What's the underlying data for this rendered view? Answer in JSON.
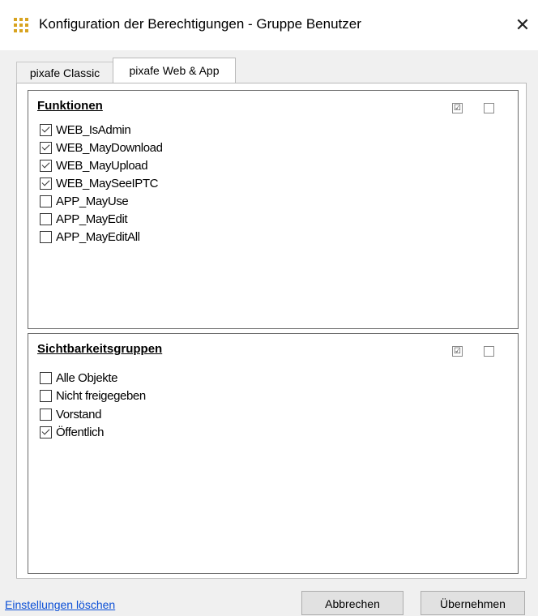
{
  "window": {
    "title": "Konfiguration der Berechtigungen - Gruppe Benutzer",
    "close_glyph": "✕",
    "icon": "app-grid-icon"
  },
  "tabs": [
    {
      "label": "pixafe Classic",
      "selected": false
    },
    {
      "label": "pixafe Web & App",
      "selected": true
    }
  ],
  "sections": {
    "funktionen": {
      "title": "Funktionen",
      "header_all_glyph": "☑",
      "header_none_glyph": "",
      "items": [
        {
          "label": "WEB_IsAdmin",
          "checked": true
        },
        {
          "label": "WEB_MayDownload",
          "checked": true
        },
        {
          "label": "WEB_MayUpload",
          "checked": true
        },
        {
          "label": "WEB_MaySeeIPTC",
          "checked": true
        },
        {
          "label": "APP_MayUse",
          "checked": false
        },
        {
          "label": "APP_MayEdit",
          "checked": false
        },
        {
          "label": "APP_MayEditAll",
          "checked": false
        }
      ]
    },
    "sichtbarkeit": {
      "title": "Sichtbarkeitsgruppen",
      "header_all_glyph": "☑",
      "header_none_glyph": "",
      "items": [
        {
          "label": "Alle Objekte",
          "checked": false
        },
        {
          "label": "Nicht freigegeben",
          "checked": false
        },
        {
          "label": "Vorstand",
          "checked": false
        },
        {
          "label": "Öffentlich",
          "checked": true
        }
      ]
    }
  },
  "footer": {
    "reset_link": "Einstellungen löschen",
    "cancel_label": "Abbrechen",
    "apply_label": "Übernehmen"
  },
  "colors": {
    "link": "#0b4fd6",
    "icon_accent": "#d8a31f"
  }
}
